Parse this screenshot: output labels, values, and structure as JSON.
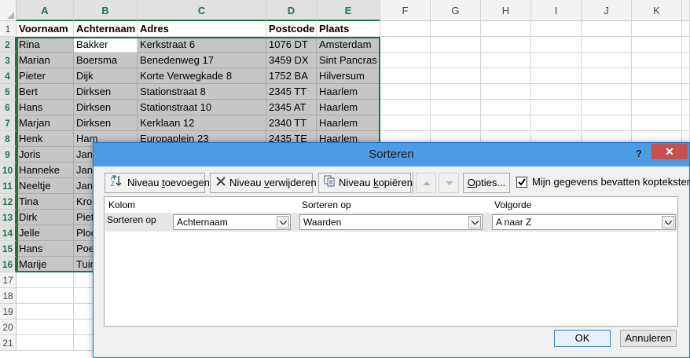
{
  "spreadsheet": {
    "columns": [
      "A",
      "B",
      "C",
      "D",
      "E",
      "F",
      "G",
      "H",
      "I",
      "J",
      "K"
    ],
    "rows": [
      "1",
      "2",
      "3",
      "4",
      "5",
      "6",
      "7",
      "8",
      "9",
      "10",
      "11",
      "12",
      "13",
      "14",
      "15",
      "16",
      "17",
      "18",
      "19",
      "20",
      "21"
    ],
    "header_cells": [
      "Voornaam",
      "Achternaam",
      "Adres",
      "Postcode",
      "Plaats"
    ],
    "data_rows": [
      [
        "Rina",
        "Bakker",
        "Kerkstraat 6",
        "1076 DT",
        "Amsterdam"
      ],
      [
        "Marian",
        "Boersma",
        "Benedenweg 17",
        "3459 DX",
        "Sint Pancras"
      ],
      [
        "Pieter",
        "Dijk",
        "Korte Verwegkade 8",
        "1752 BA",
        "Hilversum"
      ],
      [
        "Bert",
        "Dirksen",
        "Stationstraat 8",
        "2345 TT",
        "Haarlem"
      ],
      [
        "Hans",
        "Dirksen",
        "Stationstraat 10",
        "2345 AT",
        "Haarlem"
      ],
      [
        "Marjan",
        "Dirksen",
        "Kerklaan 12",
        "2340 TT",
        "Haarlem"
      ],
      [
        "Henk",
        "Ham",
        "Europaplein 23",
        "2435 TE",
        "Haarlem"
      ],
      [
        "Joris",
        "Jans",
        "",
        "",
        ""
      ],
      [
        "Hanneke",
        "Jans",
        "",
        "",
        ""
      ],
      [
        "Neeltje",
        "Jans",
        "",
        "",
        ""
      ],
      [
        "Tina",
        "Kro",
        "",
        "",
        ""
      ],
      [
        "Dirk",
        "Piet",
        "",
        "",
        ""
      ],
      [
        "Jelle",
        "Ploo",
        "",
        "",
        ""
      ],
      [
        "Hans",
        "Poe",
        "",
        "",
        ""
      ],
      [
        "Marije",
        "Tuin",
        "",
        "",
        ""
      ]
    ]
  },
  "dialog": {
    "title": "Sorteren",
    "help_label": "?",
    "close_label": "✕",
    "toolbar": {
      "add_level_pre": "Niveau ",
      "add_level_ul": "t",
      "add_level_post": "oevoegen",
      "delete_level_pre": "Niveau ",
      "delete_level_ul": "v",
      "delete_level_post": "erwijderen",
      "copy_level_pre": "Niveau ",
      "copy_level_ul": "k",
      "copy_level_post": "opiëren",
      "options_pre": "",
      "options_ul": "O",
      "options_post": "pties..."
    },
    "checkbox": {
      "checked": true,
      "label": "Mijn gegevens bevatten kopteksten"
    },
    "grid_headers": {
      "column": "Kolom",
      "sort_on": "Sorteren op",
      "order": "Volgorde"
    },
    "row": {
      "label": "Sorteren op",
      "column_value": "Achternaam",
      "sort_on_value": "Waarden",
      "order_value": "A naar Z"
    },
    "ok_label": "OK",
    "cancel_label": "Annuleren"
  },
  "colors": {
    "title_bar": "#4c9be3",
    "close_button": "#c75050",
    "selection_green": "#217346",
    "selection_shade": "#c6c6c6"
  },
  "icons": [
    "sort-add-icon",
    "delete-x-icon",
    "copy-icon",
    "move-up-icon",
    "move-down-icon",
    "checkmark-icon",
    "dropdown-arrow-icon"
  ]
}
